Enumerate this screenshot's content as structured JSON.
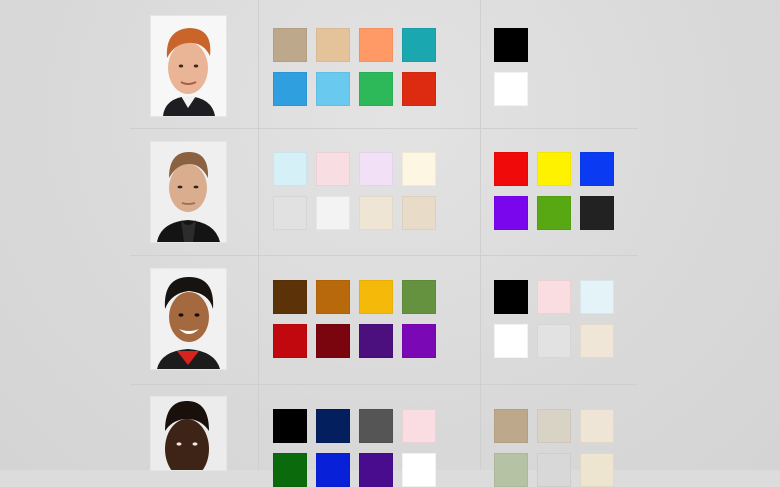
{
  "rows": [
    {
      "photo": "portrait-photo",
      "palette_main": [
        "#BDA88B",
        "#E5C39A",
        "#FF9966",
        "#1AA7B0",
        "#2F9FE0",
        "#69C9EF",
        "#2DB85A",
        "#DD2B12"
      ],
      "palette_side": [
        "#000000",
        "#FFFFFF"
      ]
    },
    {
      "photo": "portrait-photo",
      "palette_main": [
        "#D6F0F7",
        "#F8DDE3",
        "#F1E0F6",
        "#FCF6E2",
        "#E1E1E1",
        "#F3F3F3",
        "#EEE5D4",
        "#E8DCC9"
      ],
      "palette_side": [
        "#F00A0A",
        "#FFF200",
        "#0A3BF2",
        "#7A06EE",
        "#57A813",
        "#222222"
      ]
    },
    {
      "photo": "portrait-photo",
      "palette_main": [
        "#5C3209",
        "#B8690C",
        "#F5B90A",
        "#65923E",
        "#C0080E",
        "#7A050F",
        "#4B0F7E",
        "#7A08B5"
      ],
      "palette_side": [
        "#000000",
        "#F9DDE0",
        "#E4F3F8",
        "#FFFFFF",
        "#E2E2E2",
        "#EFE6D8"
      ]
    },
    {
      "photo": "portrait-photo",
      "palette_main": [
        "#000000",
        "#031F5E",
        "#555555",
        "#F9DDE3",
        "#0B6A0C",
        "#0820D8",
        "#4A0C8F",
        "#FFFFFF"
      ],
      "palette_side": [
        "#BDA88B",
        "#D9D3C6",
        "#EFE5D6",
        "#B5C2A4",
        "#D8D8D8",
        "#EEE5D1"
      ]
    }
  ]
}
